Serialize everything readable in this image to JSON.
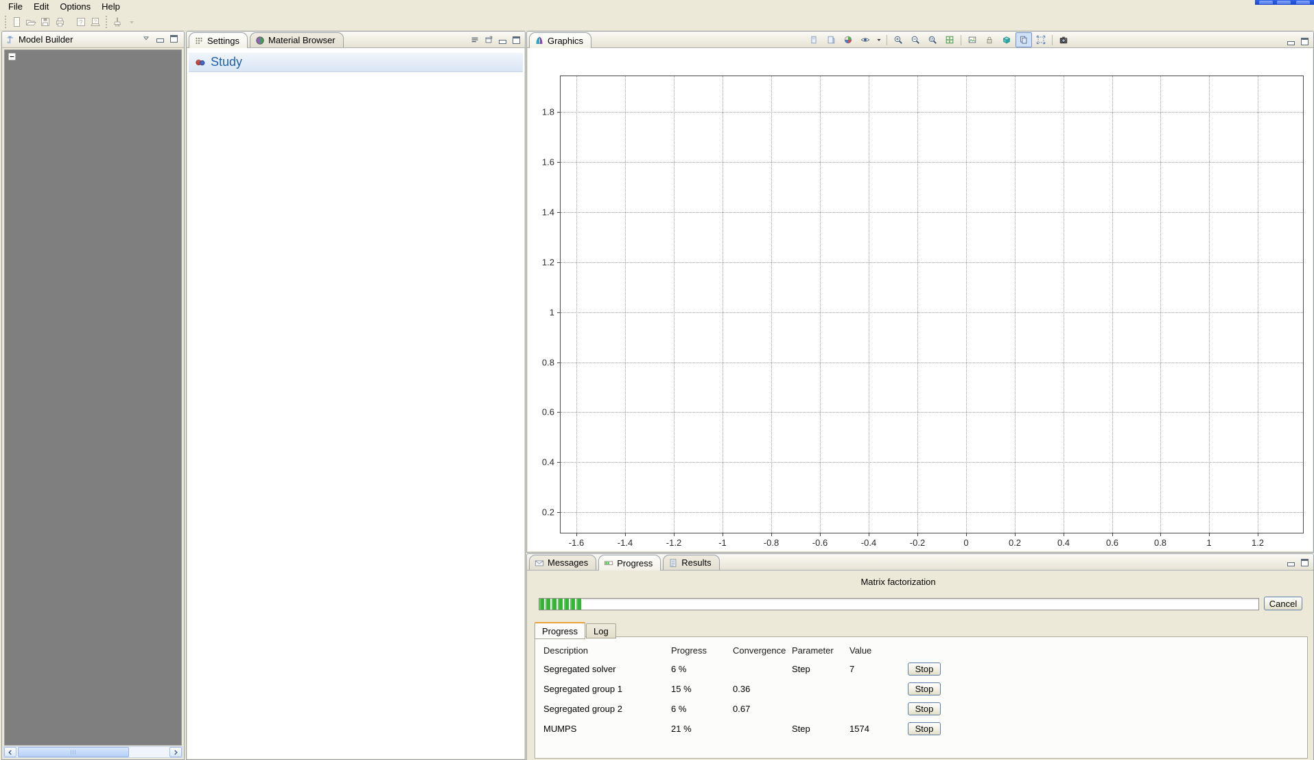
{
  "colors": {
    "window_background": "#ece9d8",
    "selection_blue": "#316ac5",
    "progress_green": "#35b435",
    "study_heading_blue": "#2161ac",
    "titlebar_blue": "#1b46c8",
    "tree_area_gray": "#7f7f7f",
    "subtab_accent_orange": "#e8a33d"
  },
  "menu_bar": {
    "items": [
      {
        "label": "File"
      },
      {
        "label": "Edit"
      },
      {
        "label": "Options"
      },
      {
        "label": "Help"
      }
    ]
  },
  "main_toolbar": {
    "items": [
      "grip",
      "new",
      "open",
      "save",
      "print",
      "gap",
      "help",
      "context-help",
      "grip",
      "brush",
      "overflow-arrow"
    ]
  },
  "model_builder_panel": {
    "title": "Model Builder",
    "window_buttons": [
      "collapse",
      "minimize",
      "maximize"
    ],
    "tree": {
      "root_expander": "collapsed-minus"
    }
  },
  "settings_panel": {
    "tabs": [
      {
        "label": "Settings",
        "icon": "settings",
        "active": true
      },
      {
        "label": "Material Browser",
        "icon": "material-browser",
        "active": false
      }
    ],
    "corner_buttons": [
      "menu-lines",
      "float",
      "minimize",
      "maximize"
    ],
    "heading": {
      "icon": "study",
      "label": "Study"
    }
  },
  "graphics_panel": {
    "tab": {
      "label": "Graphics",
      "icon": "graphics"
    },
    "toolbar": [
      {
        "name": "view-portrait"
      },
      {
        "name": "view-landscape"
      },
      {
        "name": "scene-light"
      },
      {
        "name": "visibility"
      },
      {
        "name": "dropdown-arrow",
        "narrow": true
      },
      {
        "sep": true
      },
      {
        "name": "zoom-in"
      },
      {
        "name": "zoom-out"
      },
      {
        "name": "zoom-box"
      },
      {
        "name": "zoom-extents"
      },
      {
        "sep": true
      },
      {
        "name": "image"
      },
      {
        "name": "lock"
      },
      {
        "name": "transparency"
      },
      {
        "name": "copy",
        "selected": true
      },
      {
        "name": "select-frame"
      },
      {
        "sep": true
      },
      {
        "name": "snapshot"
      }
    ],
    "window_buttons": [
      "minimize",
      "maximize"
    ]
  },
  "chart_data": {
    "type": "line",
    "title": "",
    "xlabel": "",
    "ylabel": "",
    "series": [],
    "x_ticks": [
      -1.6,
      -1.4,
      -1.2,
      -1,
      -0.8,
      -0.6,
      -0.4,
      -0.2,
      0,
      0.2,
      0.4,
      0.6,
      0.8,
      1,
      1.2
    ],
    "y_ticks": [
      0.2,
      0.4,
      0.6,
      0.8,
      1,
      1.2,
      1.4,
      1.6,
      1.8
    ],
    "xlim": [
      -1.665,
      1.385
    ],
    "ylim": [
      0.118,
      1.944
    ],
    "grid": true,
    "grid_style": "dotted",
    "legend": false
  },
  "bottom_panel": {
    "tabs": [
      {
        "label": "Messages",
        "icon": "messages",
        "active": false
      },
      {
        "label": "Progress",
        "icon": "progress",
        "active": true
      },
      {
        "label": "Results",
        "icon": "results",
        "active": false
      }
    ],
    "window_buttons": [
      "minimize",
      "maximize"
    ],
    "task_label": "Matrix factorization",
    "progress_fraction": 0.06,
    "cancel_label": "Cancel",
    "sub_tabs": [
      {
        "label": "Progress",
        "active": true
      },
      {
        "label": "Log",
        "active": false
      }
    ],
    "table": {
      "headers": [
        "Description",
        "Progress",
        "Convergence",
        "Parameter",
        "Value"
      ],
      "rows": [
        {
          "description": "Segregated solver",
          "progress": "6 %",
          "convergence": "",
          "parameter": "Step",
          "value": "7",
          "action": "Stop"
        },
        {
          "description": "Segregated group 1",
          "progress": "15 %",
          "convergence": "0.36",
          "parameter": "",
          "value": "",
          "action": "Stop"
        },
        {
          "description": "Segregated group 2",
          "progress": "6 %",
          "convergence": "0.67",
          "parameter": "",
          "value": "",
          "action": "Stop"
        },
        {
          "description": "MUMPS",
          "progress": "21 %",
          "convergence": "",
          "parameter": "Step",
          "value": "1574",
          "action": "Stop"
        }
      ]
    }
  }
}
